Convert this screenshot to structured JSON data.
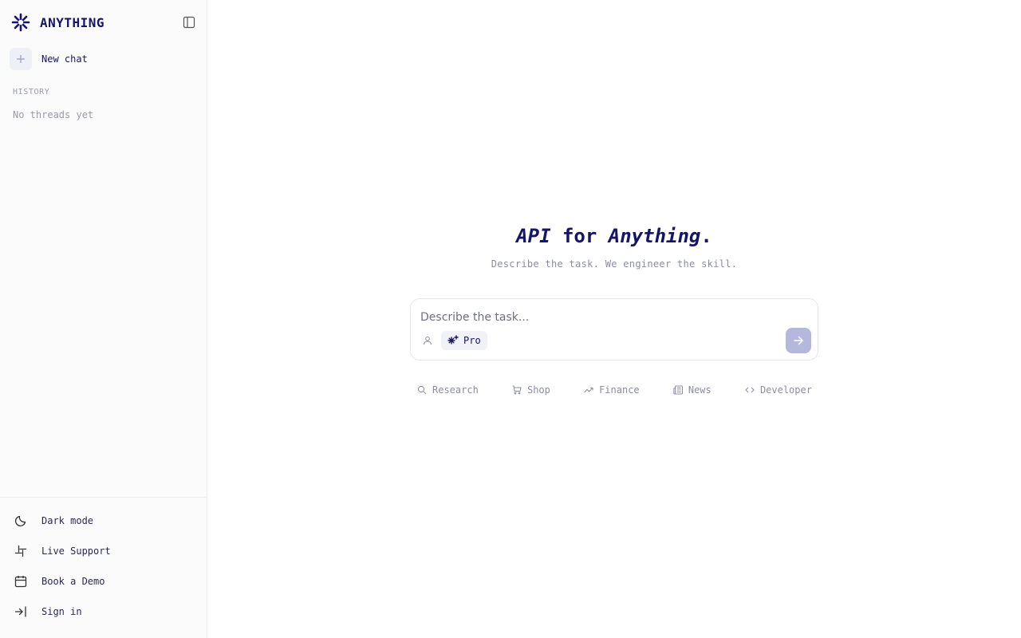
{
  "brand": {
    "name": "ANYTHING"
  },
  "sidebar": {
    "new_chat_label": "New chat",
    "history_label": "HISTORY",
    "empty_threads": "No threads yet",
    "footer": [
      {
        "label": "Dark mode",
        "icon": "moon-icon"
      },
      {
        "label": "Live Support",
        "icon": "slack-icon"
      },
      {
        "label": "Book a Demo",
        "icon": "calendar-icon"
      },
      {
        "label": "Sign in",
        "icon": "sign-in-icon"
      }
    ]
  },
  "hero": {
    "title_part1": "API",
    "title_part2": " for ",
    "title_part3": "Anything",
    "title_part4": ".",
    "subtitle": "Describe the task. We engineer the skill."
  },
  "composer": {
    "placeholder": "Describe the task...",
    "value": "",
    "mode_label": "Pro"
  },
  "suggestions": [
    {
      "label": "Research",
      "icon": "search-icon"
    },
    {
      "label": "Shop",
      "icon": "cart-icon"
    },
    {
      "label": "Finance",
      "icon": "trending-up-icon"
    },
    {
      "label": "News",
      "icon": "newspaper-icon"
    },
    {
      "label": "Developer",
      "icon": "code-icon"
    }
  ],
  "colors": {
    "brand": "#14146b",
    "muted": "#8c8ca3",
    "send_button": "#b3b8dc"
  }
}
